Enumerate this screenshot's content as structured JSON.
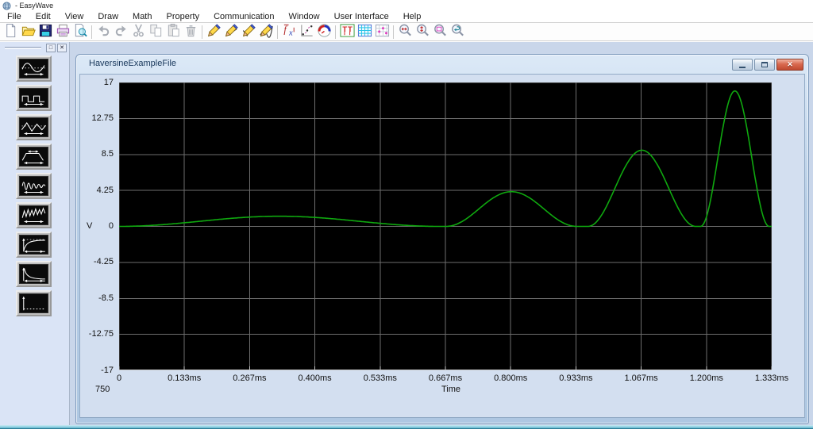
{
  "window": {
    "title": "- EasyWave"
  },
  "menu": {
    "items": [
      "File",
      "Edit",
      "View",
      "Draw",
      "Math",
      "Property",
      "Communication",
      "Window",
      "User Interface",
      "Help"
    ]
  },
  "toolbar": {
    "groups": [
      [
        "new",
        "open",
        "save",
        "print",
        "print-preview"
      ],
      [
        "undo",
        "redo",
        "cut",
        "copy",
        "paste",
        "delete"
      ],
      [
        "pencil-freehand",
        "pencil-line",
        "pencil-polyline",
        "pencil-smooth"
      ],
      [
        "equation-fx",
        "interpolate-points",
        "send-to-device"
      ],
      [
        "markers",
        "show-grid",
        "edit-points"
      ],
      [
        "zoom-horizontal",
        "zoom-vertical",
        "zoom-region",
        "zoom-previous"
      ]
    ]
  },
  "sidebar": {
    "wave_buttons": [
      "sine",
      "square",
      "triangle",
      "trapezoid",
      "arbitrary",
      "noise",
      "exp-rise",
      "exp-decay",
      "dc"
    ]
  },
  "document": {
    "title": "HaversineExampleFile",
    "points_count": "750",
    "window_buttons": [
      "minimize",
      "restore",
      "close"
    ]
  },
  "chart_data": {
    "type": "line",
    "title": "HaversineExampleFile",
    "xlabel": "Time",
    "ylabel": "V",
    "x_ticks": [
      "0",
      "0.133ms",
      "0.267ms",
      "0.400ms",
      "0.533ms",
      "0.667ms",
      "0.800ms",
      "0.933ms",
      "1.067ms",
      "1.200ms",
      "1.333ms"
    ],
    "y_ticks": [
      "17",
      "12.75",
      "8.5",
      "4.25",
      "0",
      "-4.25",
      "-8.5",
      "-12.75",
      "-17"
    ],
    "xlim_ms": [
      0,
      1.3333
    ],
    "ylim": [
      -17,
      17
    ],
    "grid": true,
    "legend": "none",
    "bg_color": "#000000",
    "grid_color": "#6E6E6E",
    "line_color": "#0FA80F",
    "waveform_description": "haversine pulse train with increasing amplitude and frequency, baseline 0 V",
    "humps": [
      {
        "t_start_ms": 0.0,
        "t_end_ms": 0.655,
        "peak_v": 1.2
      },
      {
        "t_start_ms": 0.668,
        "t_end_ms": 0.935,
        "peak_v": 4.1
      },
      {
        "t_start_ms": 0.958,
        "t_end_ms": 1.178,
        "peak_v": 9.0
      },
      {
        "t_start_ms": 1.188,
        "t_end_ms": 1.328,
        "peak_v": 16.0
      }
    ]
  }
}
